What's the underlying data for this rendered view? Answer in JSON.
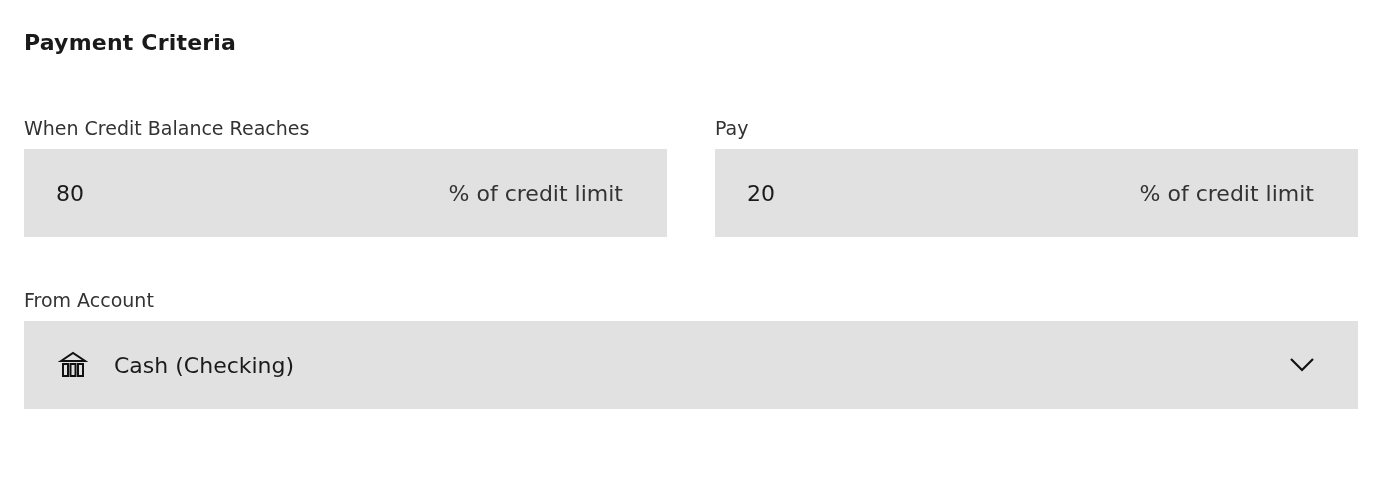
{
  "title": "Payment Criteria",
  "fields": [
    {
      "label": "When Credit Balance Reaches",
      "value": "80",
      "suffix": "% of credit limit"
    },
    {
      "label": "Pay",
      "value": "20",
      "suffix": "% of credit limit"
    }
  ],
  "account": {
    "label": "From Account",
    "value": "Cash (Checking)"
  }
}
